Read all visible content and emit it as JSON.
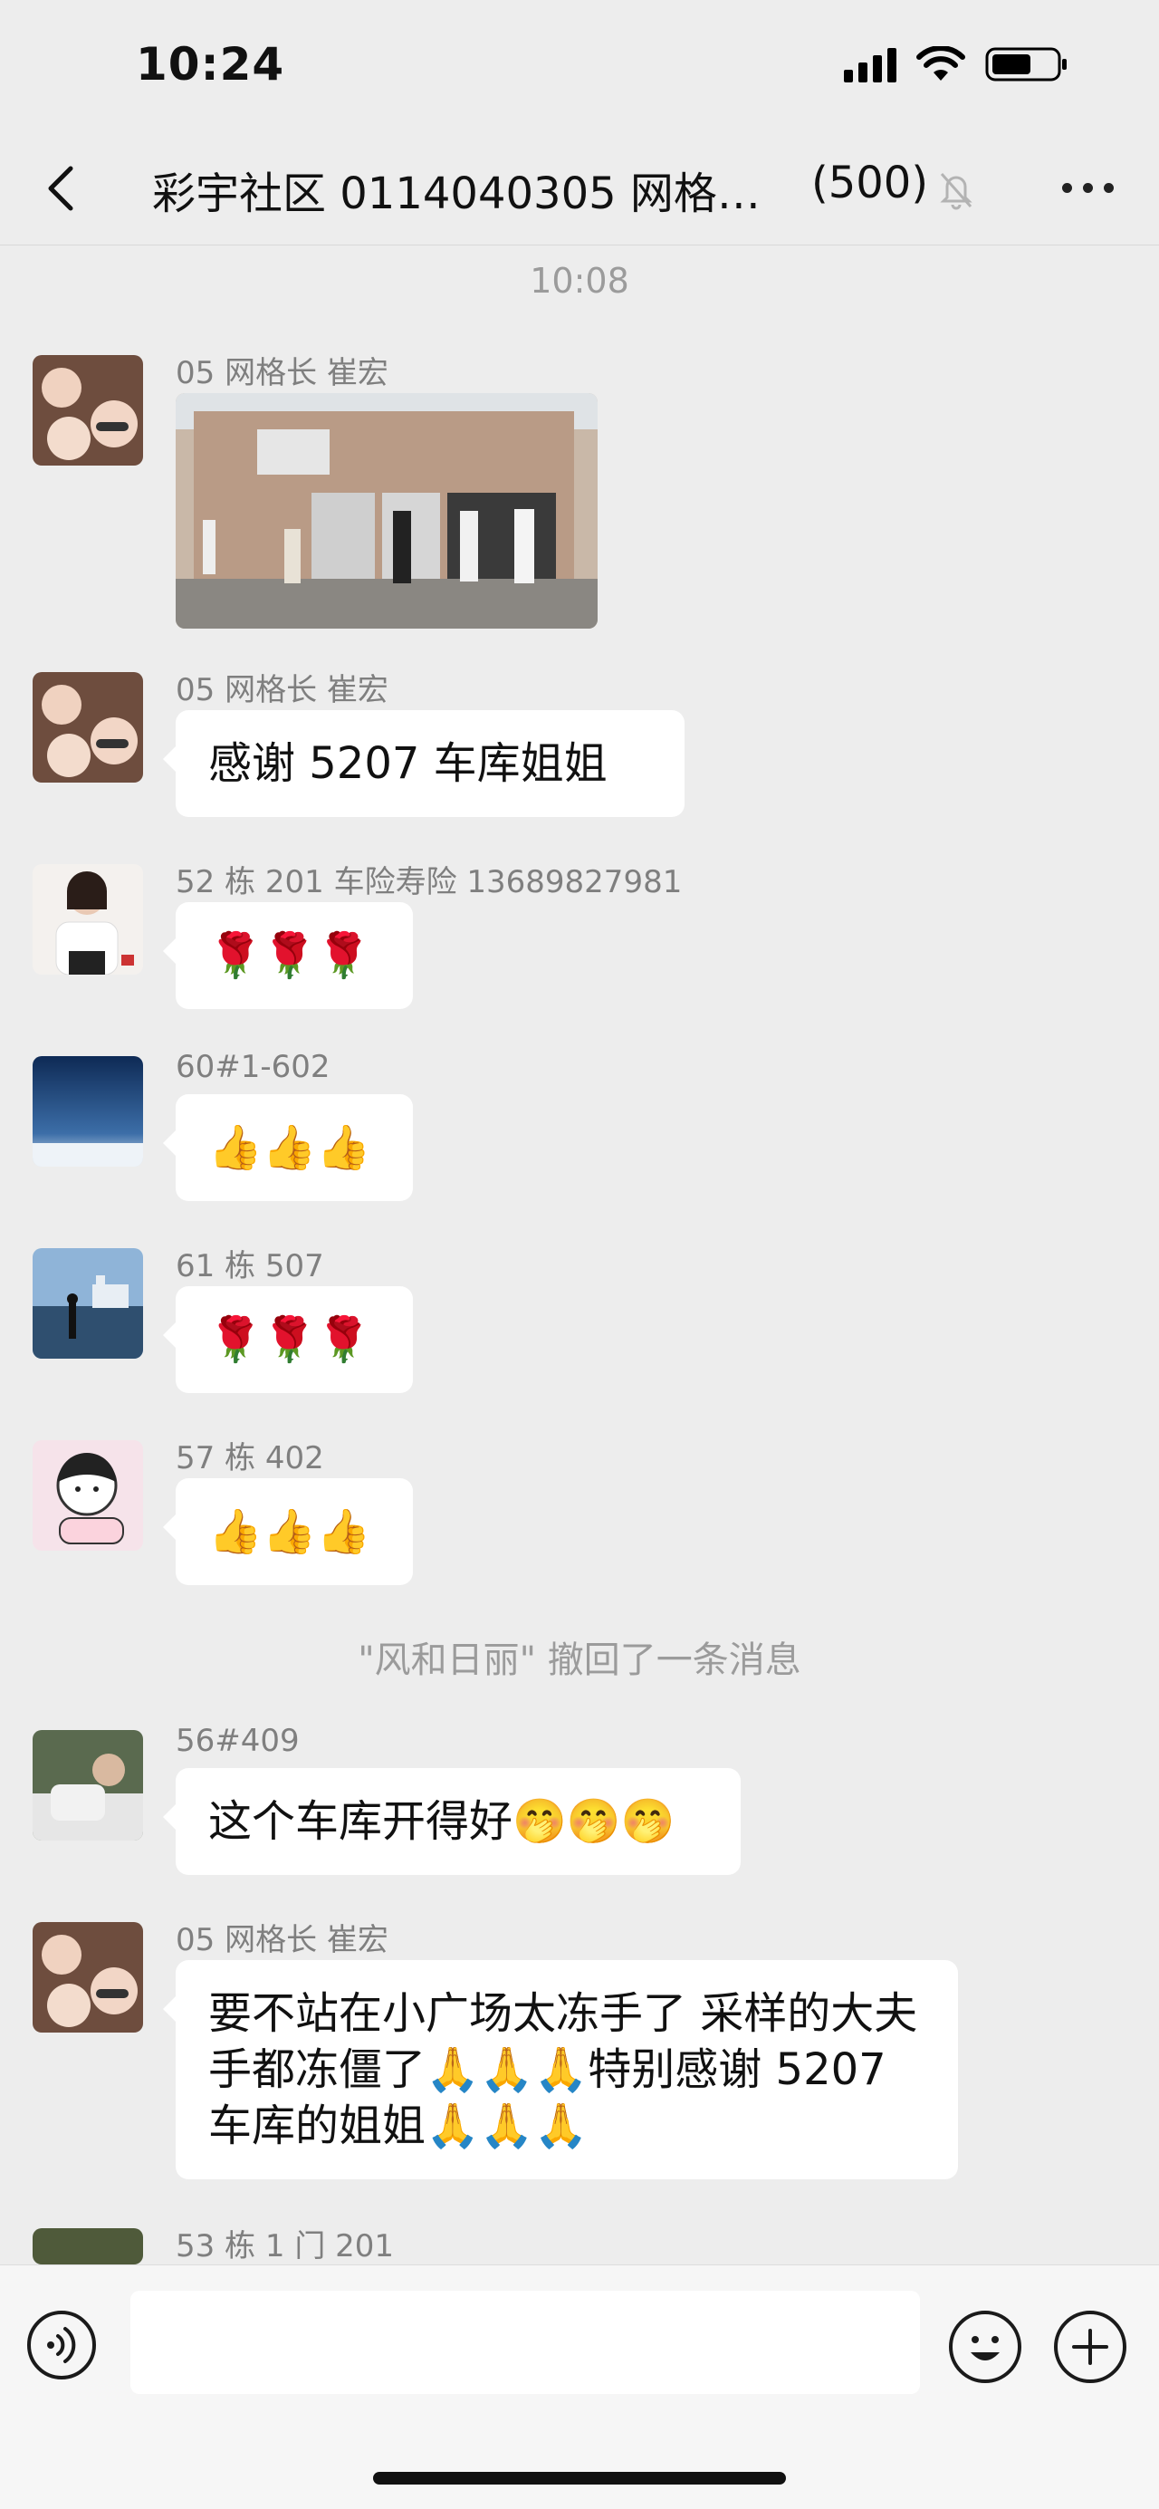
{
  "status_bar": {
    "time": "10:24"
  },
  "nav": {
    "title": "彩宇社区 0114040305 网格…",
    "member_count": "(500)"
  },
  "time_label": "10:08",
  "messages": [
    {
      "sender": "05 网格长 崔宏",
      "type": "image"
    },
    {
      "sender": "05 网格长 崔宏",
      "text": "感谢 5207 车库姐姐"
    },
    {
      "sender": "52 栋 201 车险寿险 13689827981",
      "text": "🌹🌹🌹"
    },
    {
      "sender": "60#1-602",
      "text": "👍👍👍"
    },
    {
      "sender": "61 栋 507",
      "text": "🌹🌹🌹"
    },
    {
      "sender": "57 栋 402",
      "text": "👍👍👍"
    },
    {
      "sender": "56#409",
      "text": "这个车库开得好🤭🤭🤭"
    },
    {
      "sender": "05 网格长 崔宏",
      "text": "要不站在小广场太冻手了 采样的大夫手都冻僵了🙏🙏🙏特别感谢 5207 车库的姐姐🙏🙏🙏"
    },
    {
      "sender": "53 栋 1 门 201"
    }
  ],
  "system_message": "\"风和日丽\" 撤回了一条消息",
  "input": {
    "placeholder": ""
  }
}
